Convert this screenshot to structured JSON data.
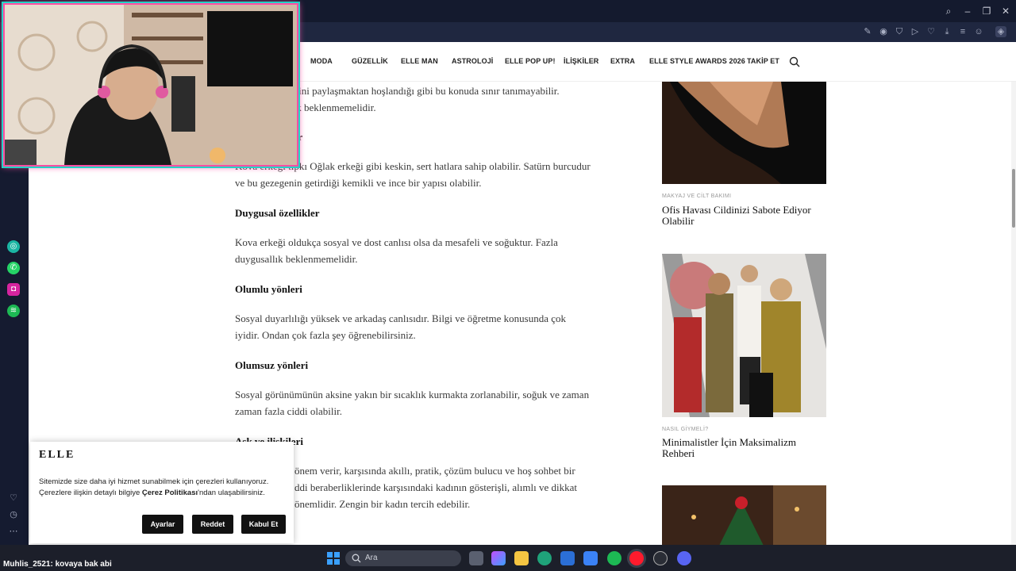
{
  "nav": {
    "items": [
      "MODA",
      "GÜZELLİK",
      "ELLE MAN",
      "ASTROLOJİ",
      "ELLE POP UP!",
      "İLİŞKİLER",
      "EXTRA",
      "ELLE STYLE AWARDS 2026",
      "TAKİP ET"
    ]
  },
  "article": {
    "p0_line1": "erini paylaşmaktan hoşlandığı gibi bu konuda sınır tanımayabilir.",
    "p0_line2": "lik beklenmemelidir.",
    "h_physical_tail": "ler",
    "p1": "Kova erkeği tıpkı Oğlak erkeği gibi keskin, sert hatlara sahip olabilir. Satürn burcudur ve bu gezegenin getirdiği kemikli ve ince bir yapısı olabilir.",
    "h_emotional": "Duygusal özellikler",
    "p2": "Kova erkeği oldukça sosyal ve dost canlısı olsa da mesafeli ve soğuktur. Fazla duygusallık beklenmemelidir.",
    "h_positive": "Olumlu yönleri",
    "p3": "Sosyal duyarlılığı yüksek ve arkadaş canlısıdır. Bilgi ve öğretme konusunda çok iyidir. Ondan çok fazla şey öğrenebilirsiniz.",
    "h_negative": "Olumsuz yönleri",
    "p4": "Sosyal görünümünün aksine yakın bir sıcaklık kurmakta zorlanabilir, soğuk ve zaman zaman fazla ciddi olabilir.",
    "h_love": "Aşk ve ilişkileri",
    "p5_line1": "önem verir, karşısında akıllı, pratik, çözüm bulucu ve hoş sohbet bir",
    "p5_line2": "ddi beraberliklerinde karşısındaki kadının gösterişli, alımlı ve dikkat",
    "p5_line3": "önemlidir. Zengin bir kadın tercih edebilir."
  },
  "sidebar_cards": [
    {
      "category": "MAKYAJ VE CİLT BAKIMI",
      "title": "Ofis Havası Cildinizi Sabote Ediyor Olabilir"
    },
    {
      "category": "NASIL GİYMELİ?",
      "title": "Minimalistler İçin Maksimalizm Rehberi"
    }
  ],
  "cookie": {
    "logo": "ELLE",
    "line1": "Sitemizde size daha iyi hizmet sunabilmek için çerezleri kullanıyoruz.",
    "line2_pre": "Çerezlere ilişkin detaylı bilgiye ",
    "line2_link": "Çerez Politikası",
    "line2_post": "'ndan ulaşabilirsiniz.",
    "btn_settings": "Ayarlar",
    "btn_reject": "Reddet",
    "btn_accept": "Kabul Et"
  },
  "taskbar": {
    "chat_user": "Muhlis_2521",
    "chat_text": ": kovaya bak abi",
    "search_placeholder": "Ara"
  },
  "colors": {
    "webcam_border": "#ff4fa3",
    "webcam_glow": "#22d3c5",
    "button": "#111111"
  }
}
